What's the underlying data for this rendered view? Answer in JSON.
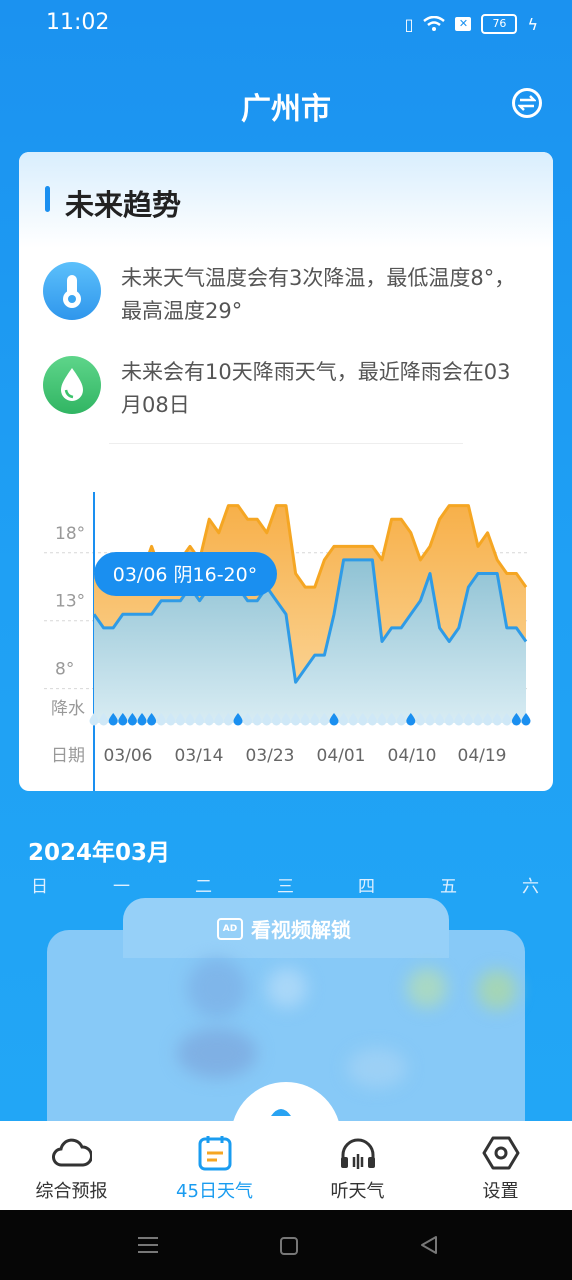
{
  "status_bar": {
    "time": "11:02",
    "battery": "76"
  },
  "header": {
    "city": "广州市",
    "swap_icon": "swap-icon"
  },
  "trend_card": {
    "title": "未来趋势",
    "temp_summary": "未来天气温度会有3次降温，最低温度8°，最高温度29°",
    "rain_summary": "未来会有10天降雨天气，最近降雨会在03月08日",
    "colors": {
      "accent": "#1a8ff0",
      "thermo": "#3aa6f2",
      "rain": "#3ec46d",
      "high": "#f5a623",
      "low": "#2f9be6"
    }
  },
  "chart_data": {
    "type": "area",
    "y_ticks": [
      "18°",
      "13°",
      "8°"
    ],
    "ylim": [
      4,
      21
    ],
    "precip_label": "降水",
    "date_label": "日期",
    "x_tick_labels": [
      "03/06",
      "03/14",
      "03/23",
      "04/01",
      "04/10",
      "04/19"
    ],
    "tooltip": "03/06 阴16-20°",
    "days": 46,
    "series": [
      {
        "values": [
          15,
          15,
          15,
          14,
          15,
          15,
          17,
          15,
          15,
          16,
          17,
          16,
          19,
          18,
          20,
          20,
          19,
          19,
          18,
          20,
          20,
          15,
          14,
          14,
          16,
          17,
          17,
          17,
          17,
          17,
          16,
          19,
          19,
          18,
          16,
          17,
          19,
          20,
          20,
          20,
          17,
          18,
          16,
          15,
          15,
          14
        ]
      },
      {
        "values": [
          12,
          11,
          11,
          12,
          12,
          12,
          12,
          13,
          13,
          13,
          14,
          13,
          14,
          14,
          14,
          14,
          13,
          13,
          14,
          13,
          12,
          7,
          8,
          9,
          9,
          12,
          16,
          16,
          16,
          16,
          10,
          11,
          11,
          12,
          13,
          15,
          11,
          10,
          11,
          14,
          15,
          15,
          15,
          11,
          11,
          10
        ]
      }
    ],
    "rain_days": [
      2,
      3,
      4,
      5,
      6,
      15,
      25,
      33,
      44,
      45
    ]
  },
  "calendar": {
    "month": "2024年03月",
    "weekdays": [
      "日",
      "一",
      "二",
      "三",
      "四",
      "五",
      "六"
    ],
    "unlock_label": "看视频解锁",
    "ad_badge": "AD"
  },
  "bottom_nav": [
    {
      "label": "综合预报",
      "icon": "cloud-icon"
    },
    {
      "label": "45日天气",
      "icon": "calendar-icon",
      "active": true
    },
    {
      "label": "听天气",
      "icon": "headphones-icon"
    },
    {
      "label": "设置",
      "icon": "settings-icon"
    }
  ]
}
